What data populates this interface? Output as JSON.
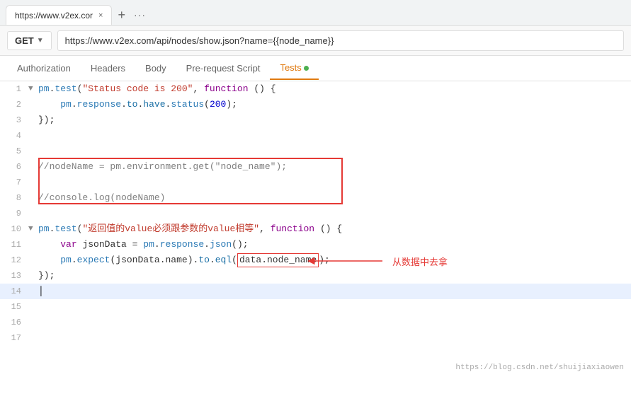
{
  "browser": {
    "tab_title": "https://www.v2ex.cor",
    "tab_close": "×",
    "tab_new": "+",
    "tab_menu": "···",
    "url": "https://www.v2ex.com/api/nodes/show.json?name={{node_name}}"
  },
  "method": {
    "label": "GET",
    "arrow": "▼"
  },
  "tabs": [
    {
      "id": "authorization",
      "label": "Authorization",
      "active": false,
      "dot": false
    },
    {
      "id": "headers",
      "label": "Headers",
      "active": false,
      "dot": false
    },
    {
      "id": "body",
      "label": "Body",
      "active": false,
      "dot": false
    },
    {
      "id": "pre-request",
      "label": "Pre-request Script",
      "active": false,
      "dot": false
    },
    {
      "id": "tests",
      "label": "Tests",
      "active": true,
      "dot": true
    }
  ],
  "code_lines": [
    {
      "num": "1",
      "arrow": "▼",
      "content": "pm.test(\"Status code is 200\", function () {",
      "active": false
    },
    {
      "num": "2",
      "arrow": "",
      "content": "    pm.response.to.have.status(200);",
      "active": false
    },
    {
      "num": "3",
      "arrow": "",
      "content": "});",
      "active": false
    },
    {
      "num": "4",
      "arrow": "",
      "content": "",
      "active": false
    },
    {
      "num": "5",
      "arrow": "",
      "content": "",
      "active": false
    },
    {
      "num": "6",
      "arrow": "",
      "content": "//nodeName = pm.environment.get(\"node_name\");",
      "active": false
    },
    {
      "num": "7",
      "arrow": "",
      "content": "",
      "active": false
    },
    {
      "num": "8",
      "arrow": "",
      "content": "//console.log(nodeName)",
      "active": false
    },
    {
      "num": "9",
      "arrow": "",
      "content": "",
      "active": false
    },
    {
      "num": "10",
      "arrow": "▼",
      "content": "pm.test(\"返回值的value必须跟参数的value相等\", function () {",
      "active": false
    },
    {
      "num": "11",
      "arrow": "",
      "content": "    var jsonData = pm.response.json();",
      "active": false
    },
    {
      "num": "12",
      "arrow": "",
      "content": "    pm.expect(jsonData.name).to.eql(data.node_name);",
      "active": false
    },
    {
      "num": "13",
      "arrow": "",
      "content": "});",
      "active": false
    },
    {
      "num": "14",
      "arrow": "",
      "content": "",
      "active": true
    },
    {
      "num": "15",
      "arrow": "",
      "content": "",
      "active": false
    },
    {
      "num": "16",
      "arrow": "",
      "content": "",
      "active": false
    },
    {
      "num": "17",
      "arrow": "",
      "content": "",
      "active": false
    }
  ],
  "annotation": {
    "text": "从数据中去拿"
  },
  "watermark": "https://blog.csdn.net/shuijiaxiaowen"
}
